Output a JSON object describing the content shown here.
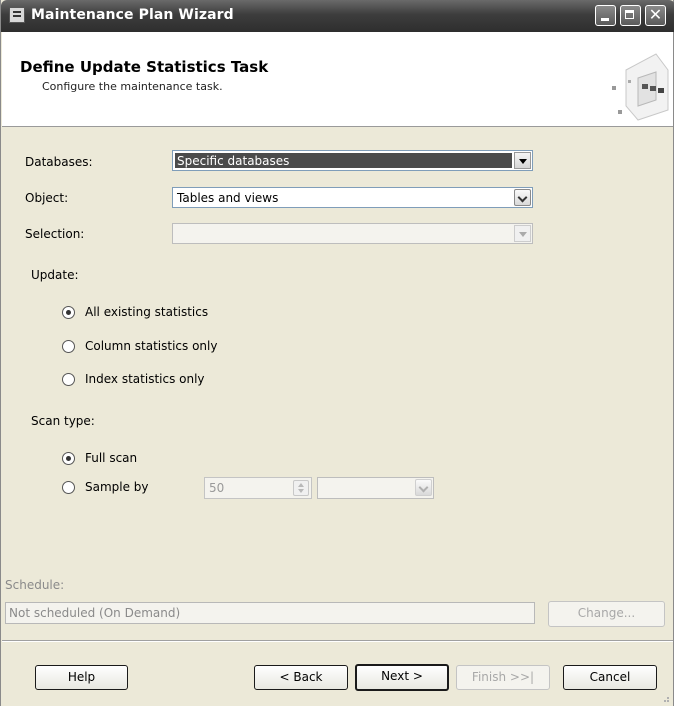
{
  "window": {
    "title": "Maintenance Plan Wizard"
  },
  "header": {
    "title": "Define Update Statistics Task",
    "subtitle": "Configure the maintenance task."
  },
  "form": {
    "databases_label": "Databases:",
    "databases_value": "Specific databases",
    "object_label": "Object:",
    "object_value": "Tables and views",
    "selection_label": "Selection:",
    "selection_value": "",
    "update_label": "Update:",
    "update_options": [
      {
        "label": "All existing statistics",
        "checked": true
      },
      {
        "label": "Column statistics only",
        "checked": false
      },
      {
        "label": "Index statistics only",
        "checked": false
      }
    ],
    "scan_label": "Scan type:",
    "scan_options": [
      {
        "label": "Full scan",
        "checked": true
      },
      {
        "label": "Sample by",
        "checked": false
      }
    ],
    "sample_value": "50",
    "sample_unit": ""
  },
  "schedule": {
    "label": "Schedule:",
    "value": "Not scheduled (On Demand)",
    "change_button": "Change..."
  },
  "footer": {
    "help": "Help",
    "back": "< Back",
    "next": "Next >",
    "finish": "Finish >>|",
    "cancel": "Cancel"
  }
}
